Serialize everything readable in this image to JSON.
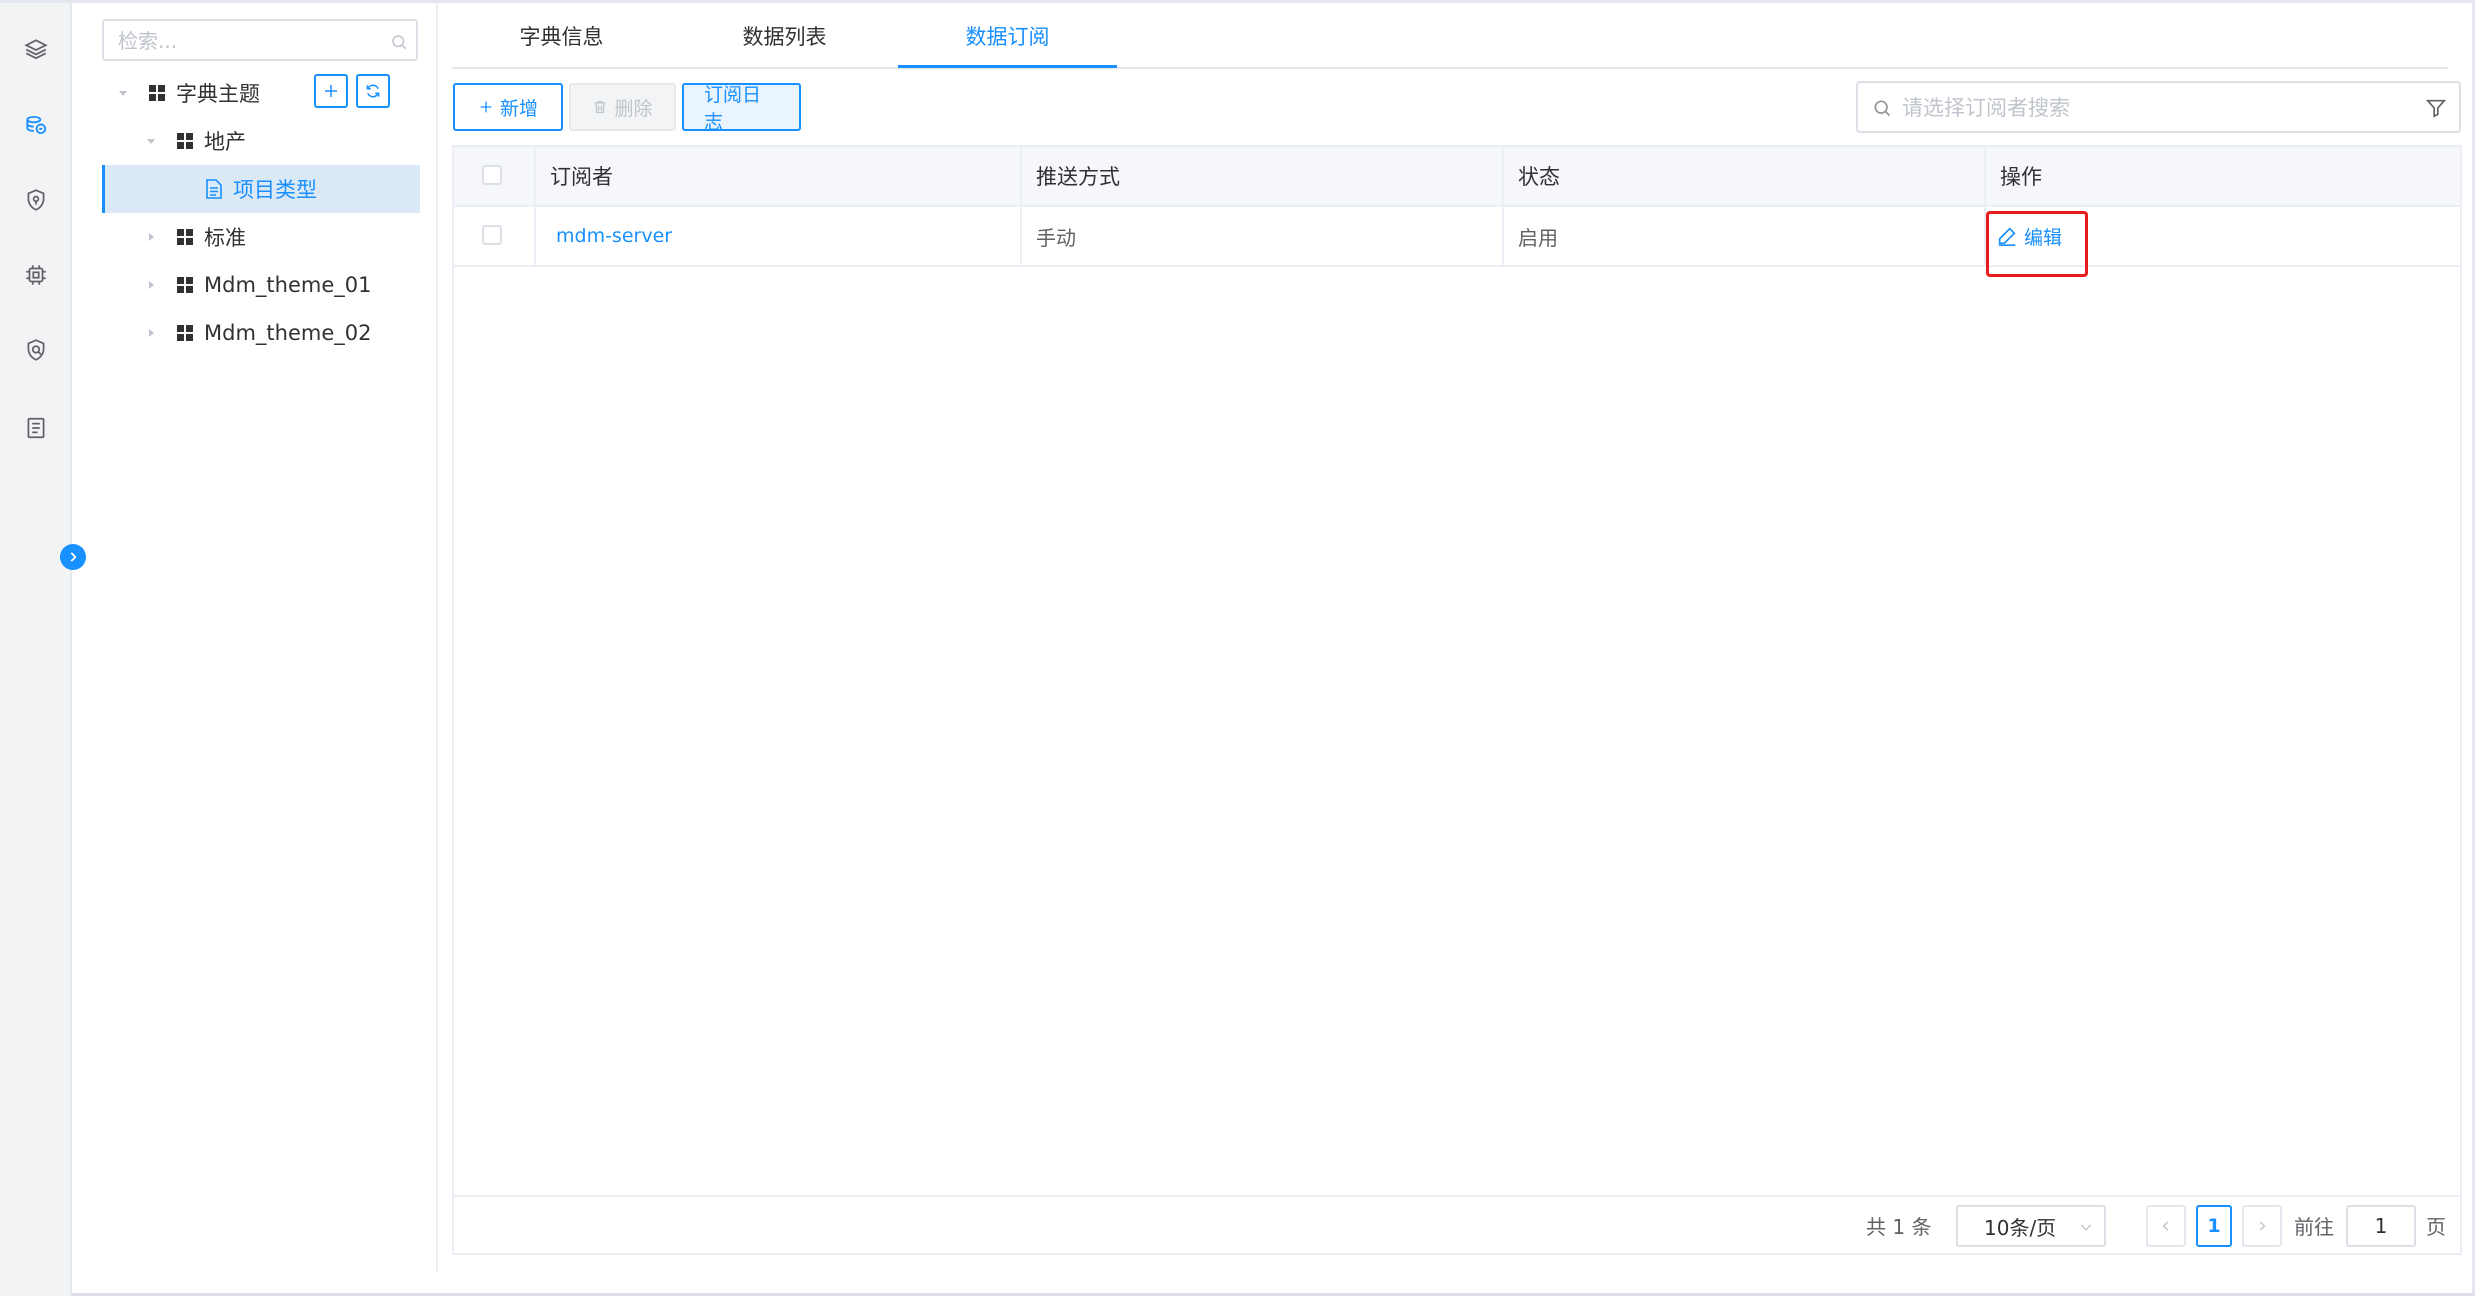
{
  "rail": {
    "icons": [
      "layers-icon",
      "database-icon",
      "shield-icon",
      "chip-icon",
      "security-icon",
      "document-icon"
    ]
  },
  "tree": {
    "search_placeholder": "检索...",
    "root": {
      "label": "字典主题"
    },
    "nodes": [
      {
        "label": "地产"
      },
      {
        "label": "项目类型"
      },
      {
        "label": "标准"
      },
      {
        "label": "Mdm_theme_01"
      },
      {
        "label": "Mdm_theme_02"
      }
    ]
  },
  "tabs": [
    {
      "label": "字典信息"
    },
    {
      "label": "数据列表"
    },
    {
      "label": "数据订阅"
    }
  ],
  "active_tab": "数据订阅",
  "toolbar": {
    "add_label": "新增",
    "delete_label": "删除",
    "log_label": "订阅日志",
    "search_placeholder": "请选择订阅者搜索"
  },
  "table": {
    "columns": [
      "订阅者",
      "推送方式",
      "状态",
      "操作"
    ],
    "rows": [
      {
        "subscriber": "mdm-server",
        "push_method": "手动",
        "status": "启用",
        "action": "编辑"
      }
    ]
  },
  "pagination": {
    "total": "共 1 条",
    "page_size": "10条/页",
    "current_page": "1",
    "goto_prefix": "前往",
    "goto_value": "1",
    "goto_suffix": "页"
  },
  "colors": {
    "accent": "#1890ff",
    "highlight": "#e81c1c"
  }
}
